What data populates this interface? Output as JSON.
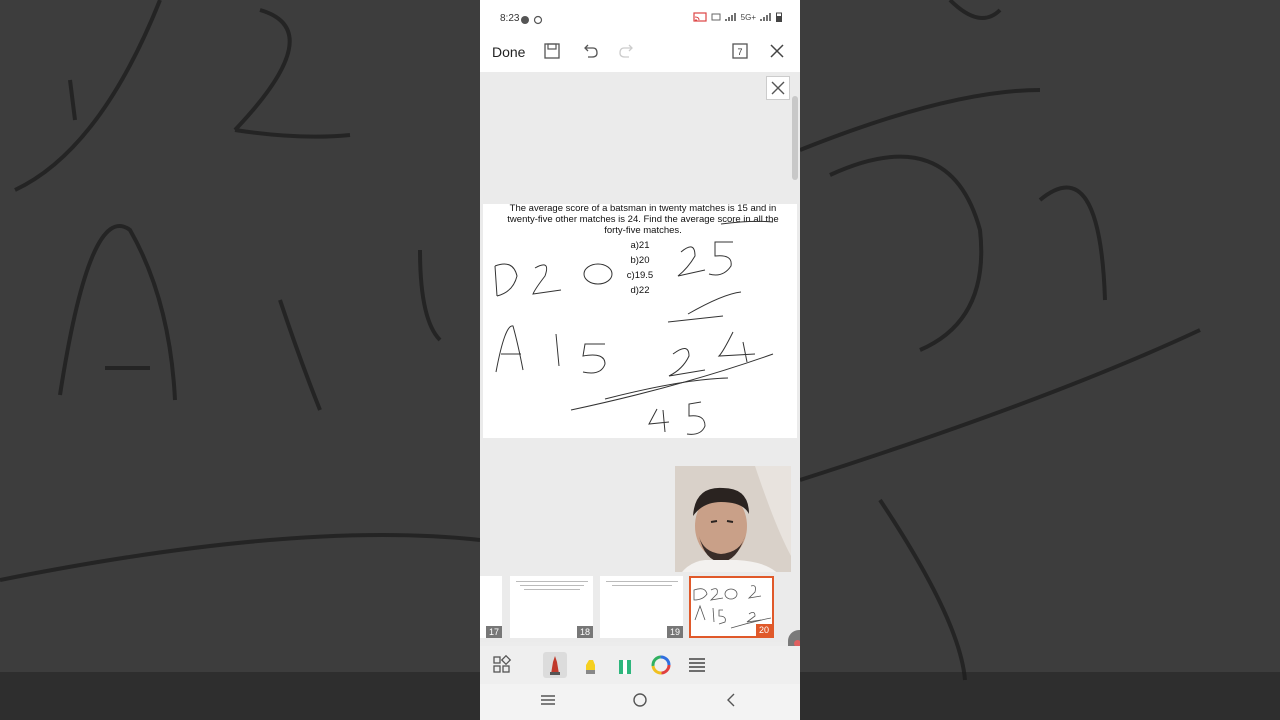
{
  "status_bar": {
    "time": "8:23",
    "right_text": "5G+"
  },
  "toolbar": {
    "done_label": "Done",
    "page_count": "7",
    "icons": [
      "save-icon",
      "undo-icon",
      "redo-icon",
      "pages-icon",
      "close-icon"
    ]
  },
  "slide": {
    "question": "The average score of a batsman in twenty matches is 15 and in twenty-five other matches is 24. Find the average score in all the forty-five matches.",
    "options": [
      "a)21",
      "b)20",
      "c)19.5",
      "d)22"
    ],
    "handwriting": [
      "D 2 0",
      "2 5",
      "A 1 5",
      "2 4",
      "4 5"
    ]
  },
  "thumbnails": [
    {
      "number": "17"
    },
    {
      "number": "18"
    },
    {
      "number": "19"
    },
    {
      "number": "20",
      "selected": true
    }
  ],
  "pen_tools": [
    "layout-icon",
    "pen-icon",
    "highlighter-icon",
    "marker-icon",
    "color-wheel-icon",
    "line-weight-icon"
  ],
  "nav": [
    "recent-apps-icon",
    "home-icon",
    "back-icon"
  ],
  "colors": {
    "accent": "#e0592a",
    "pen_red": "#c0392b",
    "highlighter": "#f5d020",
    "marker": "#2eb67d"
  }
}
